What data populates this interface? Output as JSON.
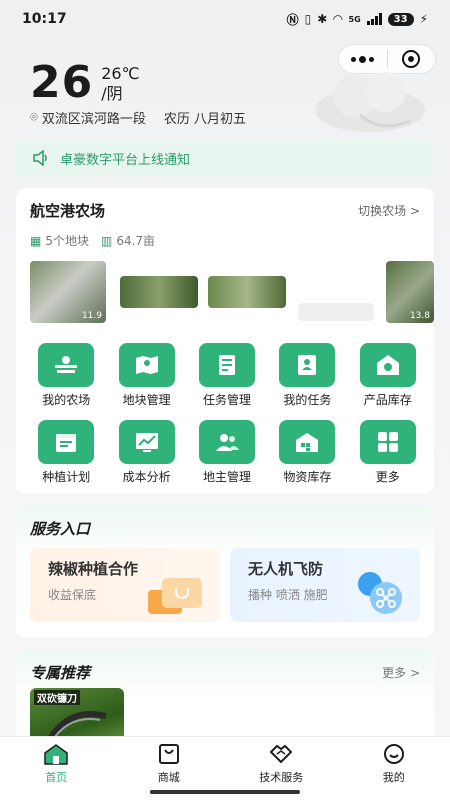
{
  "status_bar": {
    "time": "10:17",
    "network": "5G",
    "battery": "33"
  },
  "weather": {
    "temperature": "26",
    "temp_detail": "26℃",
    "condition": "/阴",
    "location": "双流区滨河路一段",
    "lunar_date": "农历 八月初五"
  },
  "notice": {
    "text": "卓豪数字平台上线通知"
  },
  "farm": {
    "name": "航空港农场",
    "switch_label": "切换农场 >",
    "plots": "5个地块",
    "area": "64.7亩",
    "thumb_labels": [
      "11.9",
      "",
      "",
      "",
      "13.8"
    ],
    "tiles": [
      {
        "label": "我的农场",
        "icon": "farm-icon"
      },
      {
        "label": "地块管理",
        "icon": "map-pin-icon"
      },
      {
        "label": "任务管理",
        "icon": "task-list-icon"
      },
      {
        "label": "我的任务",
        "icon": "user-card-icon"
      },
      {
        "label": "产品库存",
        "icon": "warehouse-icon"
      },
      {
        "label": "种植计划",
        "icon": "calendar-icon"
      },
      {
        "label": "成本分析",
        "icon": "chart-icon"
      },
      {
        "label": "地主管理",
        "icon": "users-icon"
      },
      {
        "label": "物资库存",
        "icon": "storage-icon"
      },
      {
        "label": "更多",
        "icon": "grid-more-icon"
      }
    ]
  },
  "service": {
    "title": "服务入口",
    "items": [
      {
        "title": "辣椒种植合作",
        "subtitle": "收益保底"
      },
      {
        "title": "无人机飞防",
        "subtitle": "播种 喷洒 施肥"
      }
    ]
  },
  "recommend": {
    "title": "专属推荐",
    "more": "更多 >",
    "item_tag": "双砍镰刀"
  },
  "tabbar": {
    "tabs": [
      {
        "label": "首页",
        "active": true
      },
      {
        "label": "商城",
        "active": false
      },
      {
        "label": "技术服务",
        "active": false
      },
      {
        "label": "我的",
        "active": false
      }
    ]
  },
  "colors": {
    "accent": "#2fb37a",
    "notice_bg": "#e8f6ef"
  }
}
